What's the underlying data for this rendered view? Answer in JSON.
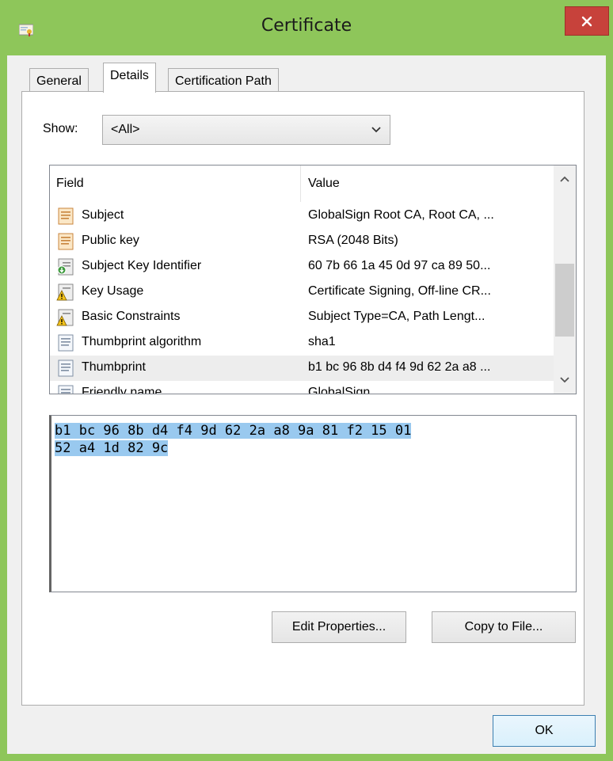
{
  "window": {
    "title": "Certificate",
    "close_glyph": "✕",
    "accent": "#8ec65a",
    "close_color": "#c7423b"
  },
  "tabs": [
    {
      "label": "General",
      "active": false
    },
    {
      "label": "Details",
      "active": true
    },
    {
      "label": "Certification Path",
      "active": false
    }
  ],
  "show": {
    "label": "Show:",
    "selected": "<All>"
  },
  "list": {
    "columns": {
      "field": "Field",
      "value": "Value"
    },
    "rows": [
      {
        "icon": "certificate-field-icon",
        "field": "Subject",
        "value": "GlobalSign Root CA, Root CA, ..."
      },
      {
        "icon": "certificate-field-icon",
        "field": "Public key",
        "value": "RSA (2048 Bits)"
      },
      {
        "icon": "extension-icon",
        "field": "Subject Key Identifier",
        "value": "60 7b 66 1a 45 0d 97 ca 89 50..."
      },
      {
        "icon": "critical-extension-icon",
        "field": "Key Usage",
        "value": "Certificate Signing, Off-line CR..."
      },
      {
        "icon": "critical-extension-icon",
        "field": "Basic Constraints",
        "value": "Subject Type=CA, Path Lengt..."
      },
      {
        "icon": "property-icon",
        "field": "Thumbprint algorithm",
        "value": "sha1"
      },
      {
        "icon": "property-icon",
        "field": "Thumbprint",
        "value": "b1 bc 96 8b d4 f4 9d 62 2a a8 ...",
        "selected": true
      },
      {
        "icon": "property-icon",
        "field": "Friendly name",
        "value": "GlobalSign"
      }
    ]
  },
  "value_box": {
    "lines": [
      "b1 bc 96 8b d4 f4 9d 62 2a a8 9a 81 f2 15 01",
      "52 a4 1d 82 9c"
    ],
    "selection_color": "#99c9ef"
  },
  "buttons": {
    "edit_properties": "Edit Properties...",
    "copy_to_file": "Copy to File...",
    "ok": "OK"
  }
}
